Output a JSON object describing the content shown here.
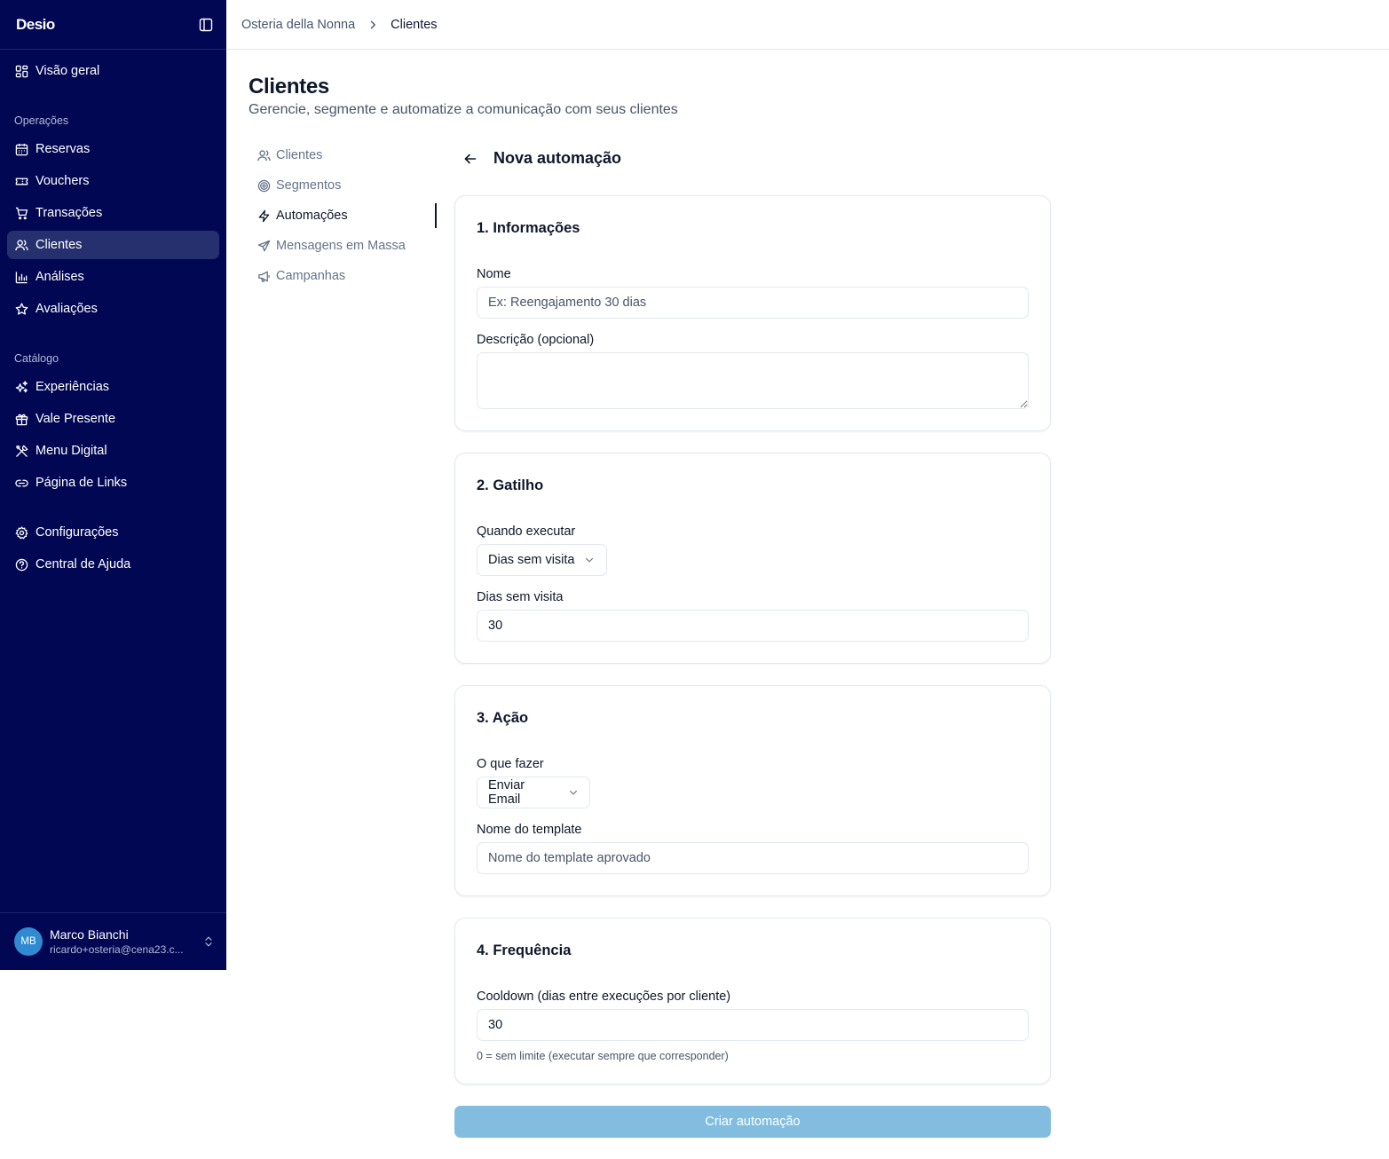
{
  "sidebar": {
    "logo": "Desio",
    "nav_top": [
      {
        "label": "Visão geral",
        "icon": "dashboard-icon"
      }
    ],
    "sections": {
      "operacoes": "Operações",
      "catalogo": "Catálogo"
    },
    "operacoes_items": [
      {
        "label": "Reservas",
        "icon": "calendar-icon"
      },
      {
        "label": "Vouchers",
        "icon": "ticket-icon"
      },
      {
        "label": "Transações",
        "icon": "cart-icon"
      },
      {
        "label": "Clientes",
        "icon": "users-icon",
        "active": true
      },
      {
        "label": "Análises",
        "icon": "bar-chart-icon"
      },
      {
        "label": "Avaliações",
        "icon": "star-icon"
      }
    ],
    "catalogo_items": [
      {
        "label": "Experiências",
        "icon": "sparkles-icon"
      },
      {
        "label": "Vale Presente",
        "icon": "gift-icon"
      },
      {
        "label": "Menu Digital",
        "icon": "utensils-icon"
      },
      {
        "label": "Página de Links",
        "icon": "link-icon"
      }
    ],
    "bottom_items": [
      {
        "label": "Configurações",
        "icon": "gear-icon"
      },
      {
        "label": "Central de Ajuda",
        "icon": "help-circle-icon"
      }
    ],
    "user": {
      "initials": "MB",
      "name": "Marco Bianchi",
      "email": "ricardo+osteria@cena23.c..."
    }
  },
  "breadcrumb": {
    "parent": "Osteria della Nonna",
    "current": "Clientes"
  },
  "page": {
    "title": "Clientes",
    "subtitle": "Gerencie, segmente e automatize a comunicação com seus clientes"
  },
  "subnav": [
    {
      "label": "Clientes",
      "icon": "users-icon"
    },
    {
      "label": "Segmentos",
      "icon": "target-icon"
    },
    {
      "label": "Automações",
      "icon": "zap-icon",
      "active": true
    },
    {
      "label": "Mensagens em Massa",
      "icon": "send-icon"
    },
    {
      "label": "Campanhas",
      "icon": "megaphone-icon"
    }
  ],
  "form": {
    "title": "Nova automação",
    "info": {
      "title": "1. Informações",
      "name_label": "Nome",
      "name_placeholder": "Ex: Reengajamento 30 dias",
      "name_value": "",
      "description_label": "Descrição (opcional)",
      "description_value": ""
    },
    "trigger": {
      "title": "2. Gatilho",
      "when_label": "Quando executar",
      "when_value": "Dias sem visita",
      "days_label": "Dias sem visita",
      "days_value": "30"
    },
    "action": {
      "title": "3. Ação",
      "what_label": "O que fazer",
      "what_value": "Enviar Email",
      "template_label": "Nome do template",
      "template_placeholder": "Nome do template aprovado",
      "template_value": ""
    },
    "frequency": {
      "title": "4. Frequência",
      "cooldown_label": "Cooldown (dias entre execuções por cliente)",
      "cooldown_value": "30",
      "cooldown_hint": "0 = sem limite (executar sempre que corresponder)"
    },
    "submit_label": "Criar automação"
  },
  "colors": {
    "sidebar_bg": "#020753",
    "sidebar_active": "#26306e",
    "avatar": "#2f8ad2",
    "submit_disabled": "#82bde0",
    "border": "#e2e8f0"
  }
}
